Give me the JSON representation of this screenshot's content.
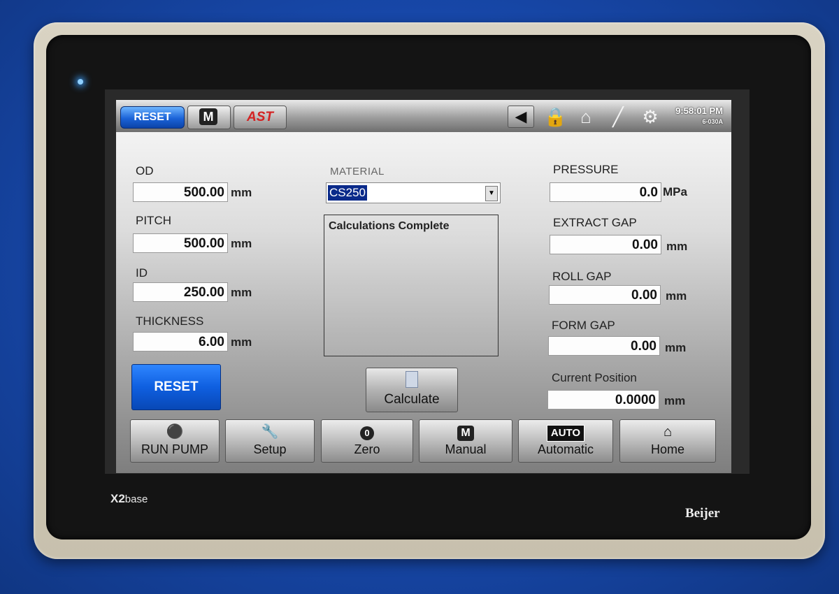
{
  "device": {
    "model_prefix": "X2",
    "model_suffix": "base",
    "manufacturer": "Beijer"
  },
  "topbar": {
    "reset_label": "RESET",
    "manual_label": "M",
    "logo_text": "AST",
    "time": "9:58:01 PM",
    "subtext": "6-030A",
    "icons": [
      "back-icon",
      "lock-icon",
      "home-icon",
      "measure-icon",
      "gear-icon"
    ]
  },
  "left": {
    "od": {
      "label": "OD",
      "value": "500.00",
      "unit": "mm"
    },
    "pitch": {
      "label": "PITCH",
      "value": "500.00",
      "unit": "mm"
    },
    "id": {
      "label": "ID",
      "value": "250.00",
      "unit": "mm"
    },
    "thickness": {
      "label": "THICKNESS",
      "value": "6.00",
      "unit": "mm"
    },
    "reset_label": "RESET"
  },
  "center": {
    "material_label": "MATERIAL",
    "material_value": "CS250",
    "status_text": "Calculations Complete",
    "calculate_label": "Calculate"
  },
  "right": {
    "pressure": {
      "label": "PRESSURE",
      "value": "0.0",
      "unit": "MPa"
    },
    "extract_gap": {
      "label": "EXTRACT GAP",
      "value": "0.00",
      "unit": "mm"
    },
    "roll_gap": {
      "label": "ROLL GAP",
      "value": "0.00",
      "unit": "mm"
    },
    "form_gap": {
      "label": "FORM GAP",
      "value": "0.00",
      "unit": "mm"
    },
    "current_position": {
      "label": "Current Position",
      "value": "0.0000",
      "unit": "mm"
    }
  },
  "nav": {
    "run_pump": "RUN PUMP",
    "setup": "Setup",
    "zero": "Zero",
    "zero_badge": "0",
    "manual": "Manual",
    "manual_badge": "M",
    "automatic": "Automatic",
    "auto_badge": "AUTO",
    "home": "Home"
  },
  "colors": {
    "background": "#1747a8",
    "reset_blue": "#0f5fe0",
    "logo_red": "#d42222",
    "selection": "#0a2a8a"
  }
}
